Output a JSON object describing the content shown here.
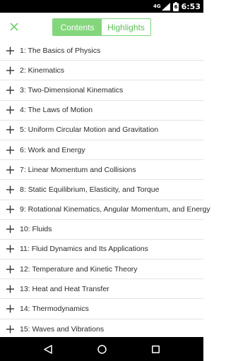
{
  "status_bar": {
    "network": "4G",
    "battery_level": "6",
    "time": "6:53"
  },
  "toolbar": {
    "tabs": [
      {
        "label": "Contents",
        "active": true
      },
      {
        "label": "Highlights",
        "active": false
      }
    ],
    "accent_color": "#84d67c"
  },
  "chapters": [
    {
      "label": "1: The Basics of Physics"
    },
    {
      "label": "2: Kinematics"
    },
    {
      "label": "3: Two-Dimensional Kinematics"
    },
    {
      "label": "4: The Laws of Motion"
    },
    {
      "label": "5: Uniform Circular Motion and Gravitation"
    },
    {
      "label": "6: Work and Energy"
    },
    {
      "label": "7: Linear Momentum and Collisions"
    },
    {
      "label": "8: Static Equilibrium, Elasticity, and Torque"
    },
    {
      "label": "9: Rotational Kinematics, Angular Momentum, and Energy"
    },
    {
      "label": "10: Fluids"
    },
    {
      "label": "11: Fluid Dynamics and Its Applications"
    },
    {
      "label": "12: Temperature and Kinetic Theory"
    },
    {
      "label": "13: Heat and Heat Transfer"
    },
    {
      "label": "14: Thermodynamics"
    },
    {
      "label": "15: Waves and Vibrations"
    }
  ]
}
